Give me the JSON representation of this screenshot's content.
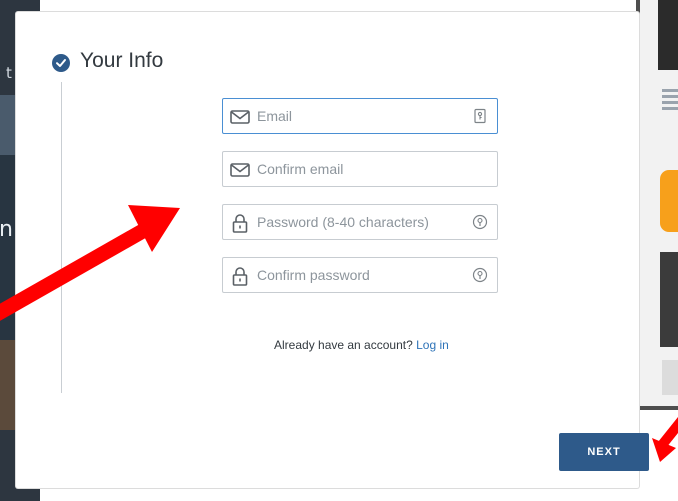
{
  "background": {
    "left_fragment_top": "t",
    "left_fragment_mid": "n"
  },
  "step": {
    "title": "Your Info",
    "icon": "check-circle-icon"
  },
  "form": {
    "email_placeholder": "Email",
    "confirm_email_placeholder": "Confirm email",
    "password_placeholder": "Password (8-40 characters)",
    "confirm_password_placeholder": "Confirm password"
  },
  "login": {
    "prompt": "Already have an account? ",
    "link": "Log in"
  },
  "actions": {
    "next_label": "NEXT"
  },
  "colors": {
    "primary": "#2e5a8a",
    "link": "#2e73b8",
    "annotation_arrow": "#ff0000"
  }
}
